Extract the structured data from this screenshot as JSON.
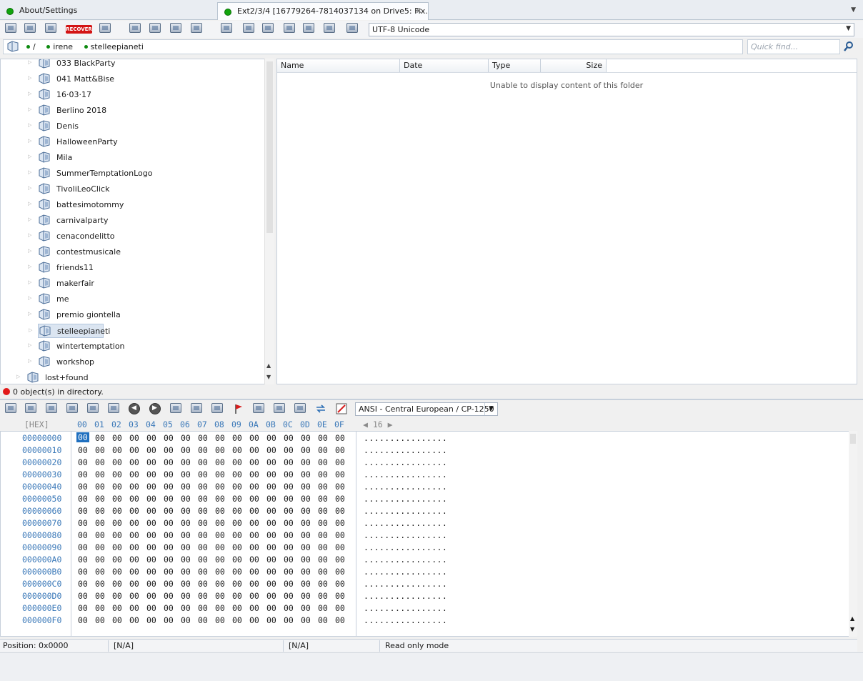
{
  "tabs": [
    {
      "label": "About/Settings"
    },
    {
      "label": "Ext2/3/4 [16779264-7814037134 on Drive5: Fix..."
    }
  ],
  "toolbar": {
    "recover_label": "RECOVER",
    "encoding": "UTF-8 Unicode"
  },
  "path": {
    "root": "/",
    "segments": [
      "irene",
      "stelleepianeti"
    ]
  },
  "quick_find": {
    "placeholder": "Quick find..."
  },
  "tree": {
    "items": [
      "033 BlackParty",
      "041 Matt&Bise",
      "16·03·17",
      "Berlino 2018",
      "Denis",
      "HalloweenParty",
      "Mila",
      "SummerTemptationLogo",
      "TivoliLeoClick",
      "battesimotommy",
      "carnivalparty",
      "cenacondelitto",
      "contestmusicale",
      "friends11",
      "makerfair",
      "me",
      "premio giontella",
      "stelleepianeti",
      "wintertemptation",
      "workshop"
    ],
    "selected": "stelleepianeti",
    "parent_item": "lost+found"
  },
  "file_list": {
    "columns": [
      "Name",
      "Date",
      "Type",
      "Size"
    ],
    "empty_message": "Unable to display content of this folder"
  },
  "dir_status": "0 object(s) in directory.",
  "hex_toolbar": {
    "codepage": "ANSI - Central European / CP-1250"
  },
  "hex_header": {
    "label": "[HEX]",
    "columns": [
      "00",
      "01",
      "02",
      "03",
      "04",
      "05",
      "06",
      "07",
      "08",
      "09",
      "0A",
      "0B",
      "0C",
      "0D",
      "0E",
      "0F"
    ],
    "width": "16"
  },
  "hex_rows": [
    {
      "offset": "00000000",
      "ascii": "................"
    },
    {
      "offset": "00000010",
      "ascii": "................"
    },
    {
      "offset": "00000020",
      "ascii": "................"
    },
    {
      "offset": "00000030",
      "ascii": "................"
    },
    {
      "offset": "00000040",
      "ascii": "................"
    },
    {
      "offset": "00000050",
      "ascii": "................"
    },
    {
      "offset": "00000060",
      "ascii": "................"
    },
    {
      "offset": "00000070",
      "ascii": "................"
    },
    {
      "offset": "00000080",
      "ascii": "................"
    },
    {
      "offset": "00000090",
      "ascii": "................"
    },
    {
      "offset": "000000A0",
      "ascii": "................"
    },
    {
      "offset": "000000B0",
      "ascii": "................"
    },
    {
      "offset": "000000C0",
      "ascii": "................"
    },
    {
      "offset": "000000D0",
      "ascii": "................"
    },
    {
      "offset": "000000E0",
      "ascii": "................"
    },
    {
      "offset": "000000F0",
      "ascii": "................"
    }
  ],
  "hex_byte_value": "00",
  "status": {
    "position": "Position: 0x0000",
    "field2": "[N/A]",
    "field3": "[N/A]",
    "mode": "Read only mode"
  },
  "colors": {
    "accent": "#1f6fbf",
    "ok_dot": "#11a40d",
    "error_dot": "#e21a1a"
  }
}
